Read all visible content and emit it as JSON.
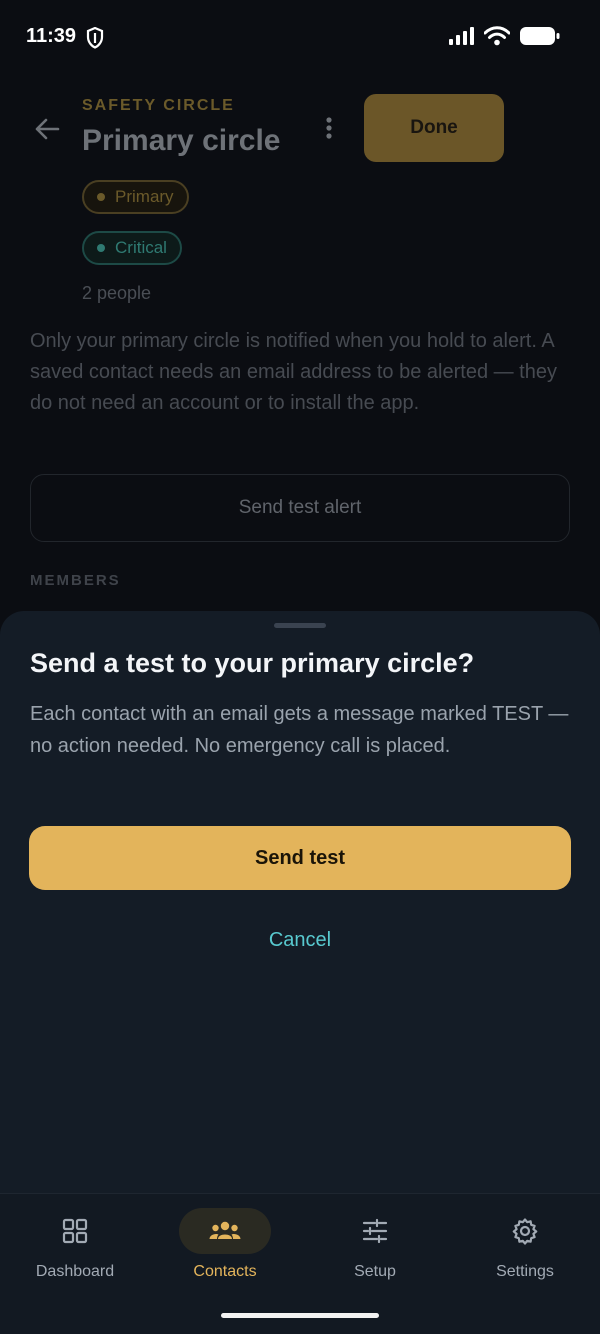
{
  "status_bar": {
    "time": "11:39"
  },
  "header": {
    "overline": "SAFETY CIRCLE",
    "title": "Primary circle",
    "done_label": "Done"
  },
  "tags": [
    {
      "label": "Primary",
      "color": "#e3b45b"
    },
    {
      "label": "Critical",
      "color": "#3fb8ad"
    }
  ],
  "people_count": "2 people",
  "description": "Only your primary circle is notified when you hold to alert. A saved contact needs an email address to be alerted — they do not need an account or to install the app.",
  "send_test_alert_label": "Send test alert",
  "members_label": "MEMBERS",
  "sheet": {
    "title": "Send a test to your primary circle?",
    "body": "Each contact with an email gets a message marked TEST — no action needed. No emergency call is placed.",
    "confirm_label": "Send test",
    "cancel_label": "Cancel"
  },
  "nav": {
    "items": [
      {
        "label": "Dashboard",
        "icon": "grid-icon"
      },
      {
        "label": "Contacts",
        "icon": "people-icon",
        "active": true
      },
      {
        "label": "Setup",
        "icon": "sliders-icon"
      },
      {
        "label": "Settings",
        "icon": "gear-icon"
      }
    ]
  },
  "colors": {
    "accent": "#e3b45b",
    "link": "#58c9cf",
    "sheet_bg": "#141c26"
  }
}
